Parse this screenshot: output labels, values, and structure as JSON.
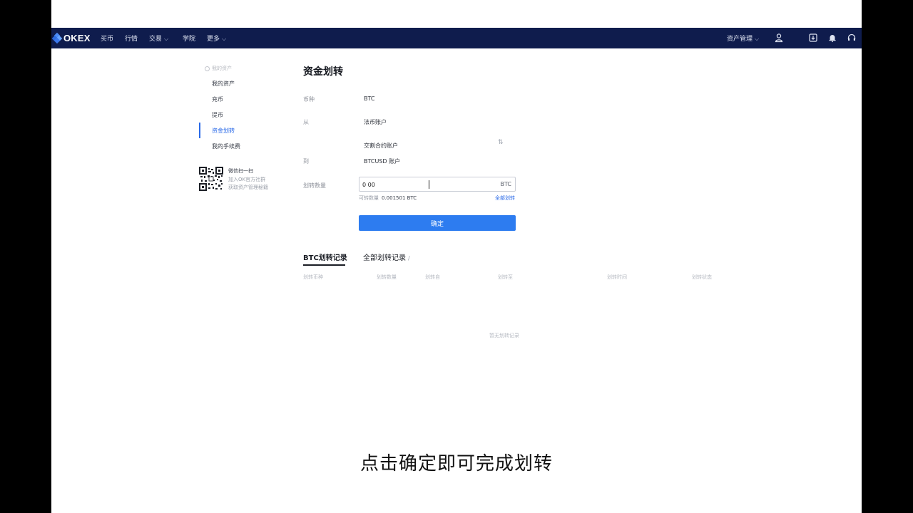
{
  "nav": {
    "logo": "OKEX",
    "items": [
      {
        "label": "买币",
        "has_dropdown": false
      },
      {
        "label": "行情",
        "has_dropdown": false
      },
      {
        "label": "交易",
        "has_dropdown": true
      },
      {
        "label": "学院",
        "has_dropdown": false
      },
      {
        "label": "更多",
        "has_dropdown": true
      }
    ],
    "asset_mgmt": "资产管理",
    "icons": [
      "user-icon",
      "download-icon",
      "bell-icon",
      "headset-icon"
    ]
  },
  "sidebar": {
    "section": "我的资产",
    "items": [
      {
        "label": "我的资产",
        "active": false
      },
      {
        "label": "充币",
        "active": false
      },
      {
        "label": "提币",
        "active": false
      },
      {
        "label": "资金划转",
        "active": true
      },
      {
        "label": "我的手续费",
        "active": false
      }
    ],
    "qr_title": "微信扫一扫",
    "qr_line1": "加入OK官方社群",
    "qr_line2": "获取资产管理秘籍"
  },
  "form": {
    "title": "资金划转",
    "currency_label": "币种",
    "currency_value": "BTC",
    "from_label": "从",
    "from_value": "法币账户",
    "middle_value": "交割合约账户",
    "to_label": "到",
    "to_value": "BTCUSD 账户",
    "amount_label": "划转数量",
    "amount_value": "0 00",
    "amount_unit": "BTC",
    "available_label": "可转数量",
    "available_value": "0.001501 BTC",
    "transfer_all": "全部划转",
    "confirm": "确定"
  },
  "records": {
    "tab_active": "BTC划转记录",
    "tab_other": "全部划转记录",
    "columns": [
      "划转币种",
      "划转数量",
      "划转自",
      "划转至",
      "划转时间",
      "划转状态"
    ],
    "empty": "暂无划转记录"
  },
  "caption": "点击确定即可完成划转",
  "colors": {
    "nav_bg": "#0f1c4d",
    "accent": "#2d7cf0"
  }
}
